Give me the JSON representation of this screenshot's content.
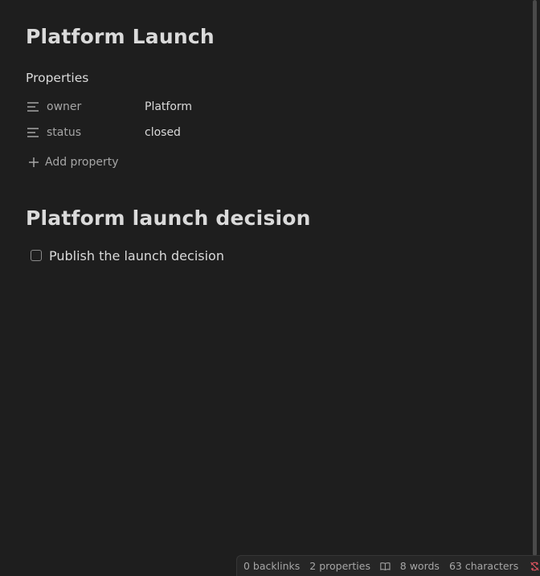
{
  "note": {
    "title": "Platform Launch",
    "properties_heading": "Properties",
    "properties": [
      {
        "key": "owner",
        "value": "Platform",
        "icon": "text-lines-icon"
      },
      {
        "key": "status",
        "value": "closed",
        "icon": "text-lines-icon"
      }
    ],
    "add_property_label": "Add property",
    "heading": "Platform launch decision",
    "task": {
      "text": "Publish the launch decision",
      "checked": false
    }
  },
  "statusbar": {
    "backlinks": "0 backlinks",
    "properties": "2 properties",
    "reading_icon": "book-open-icon",
    "words": "8 words",
    "characters": "63 characters",
    "sync_icon": "sync-off-icon",
    "sync_color": "#e05561"
  }
}
